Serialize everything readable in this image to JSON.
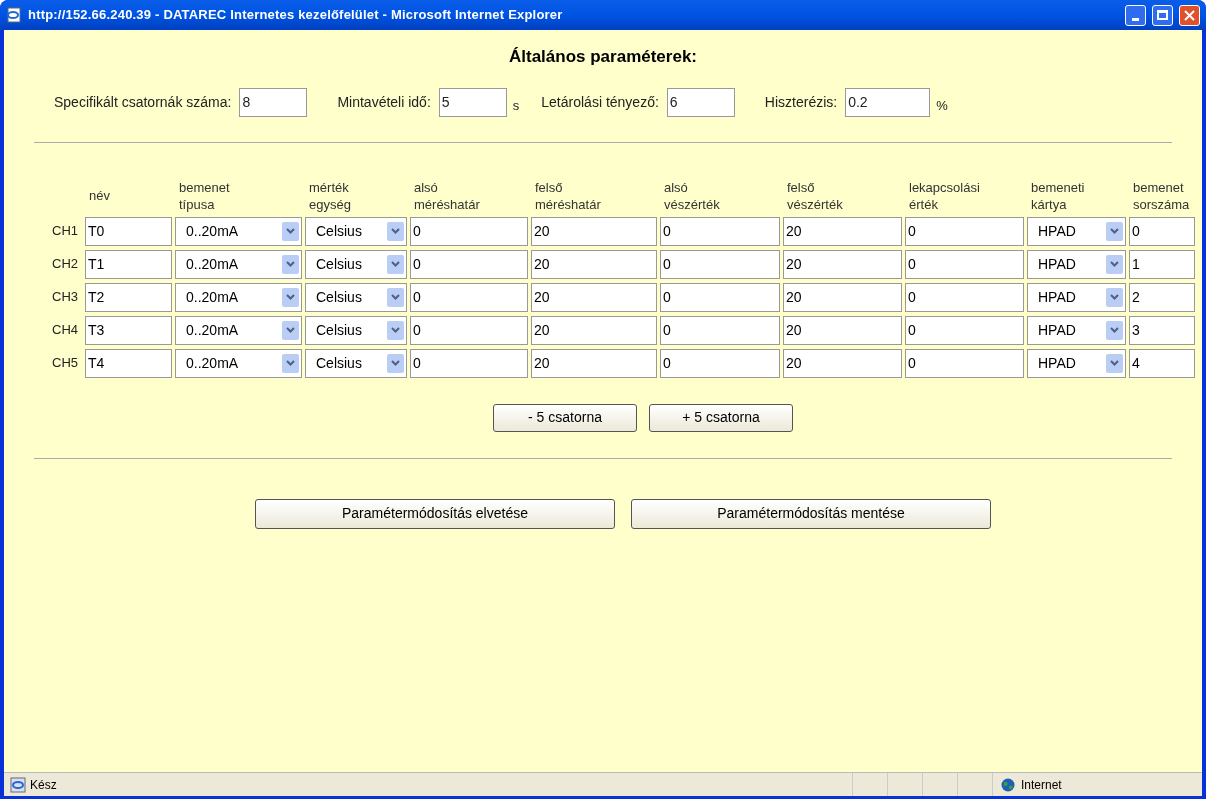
{
  "window": {
    "title": "http://152.66.240.39 - DATAREC Internetes kezelőfelület - Microsoft Internet Explorer"
  },
  "heading": "Általános paraméterek:",
  "general_fields": [
    {
      "label": "Specifikált csatornák száma:",
      "value": "8"
    },
    {
      "label": "Mintavételi idő:",
      "value": "5",
      "unit": "s"
    },
    {
      "label": "Letárolási tényező:",
      "value": "6"
    },
    {
      "label": "Hiszterézis:",
      "value": "0.2",
      "unit": "%"
    }
  ],
  "columns": [
    {
      "label": "név",
      "kind": "text"
    },
    {
      "label": "bemenet típusa",
      "kind": "select"
    },
    {
      "label": "mérték egység",
      "kind": "select"
    },
    {
      "label": "alsó méréshatár",
      "kind": "text"
    },
    {
      "label": "felső méréshatár",
      "kind": "text"
    },
    {
      "label": "alsó vészérték",
      "kind": "text"
    },
    {
      "label": "felső vészérték",
      "kind": "text"
    },
    {
      "label": "lekapcsolási érték",
      "kind": "text"
    },
    {
      "label": "bemeneti kártya",
      "kind": "select"
    },
    {
      "label": "bemenet sorszáma",
      "kind": "text"
    }
  ],
  "rows": [
    {
      "channel": "CH1",
      "values": [
        "T0",
        "0..20mA",
        "Celsius",
        "0",
        "20",
        "0",
        "20",
        "0",
        "HPAD",
        "0"
      ]
    },
    {
      "channel": "CH2",
      "values": [
        "T1",
        "0..20mA",
        "Celsius",
        "0",
        "20",
        "0",
        "20",
        "0",
        "HPAD",
        "1"
      ]
    },
    {
      "channel": "CH3",
      "values": [
        "T2",
        "0..20mA",
        "Celsius",
        "0",
        "20",
        "0",
        "20",
        "0",
        "HPAD",
        "2"
      ]
    },
    {
      "channel": "CH4",
      "values": [
        "T3",
        "0..20mA",
        "Celsius",
        "0",
        "20",
        "0",
        "20",
        "0",
        "HPAD",
        "3"
      ]
    },
    {
      "channel": "CH5",
      "values": [
        "T4",
        "0..20mA",
        "Celsius",
        "0",
        "20",
        "0",
        "20",
        "0",
        "HPAD",
        "4"
      ]
    }
  ],
  "channel_buttons": [
    "- 5 csatorna",
    "+ 5 csatorna"
  ],
  "action_buttons": [
    "Paramétermódosítás elvetése",
    "Paramétermódosítás mentése"
  ],
  "status_bar": {
    "status": "Kész",
    "zone": "Internet"
  }
}
